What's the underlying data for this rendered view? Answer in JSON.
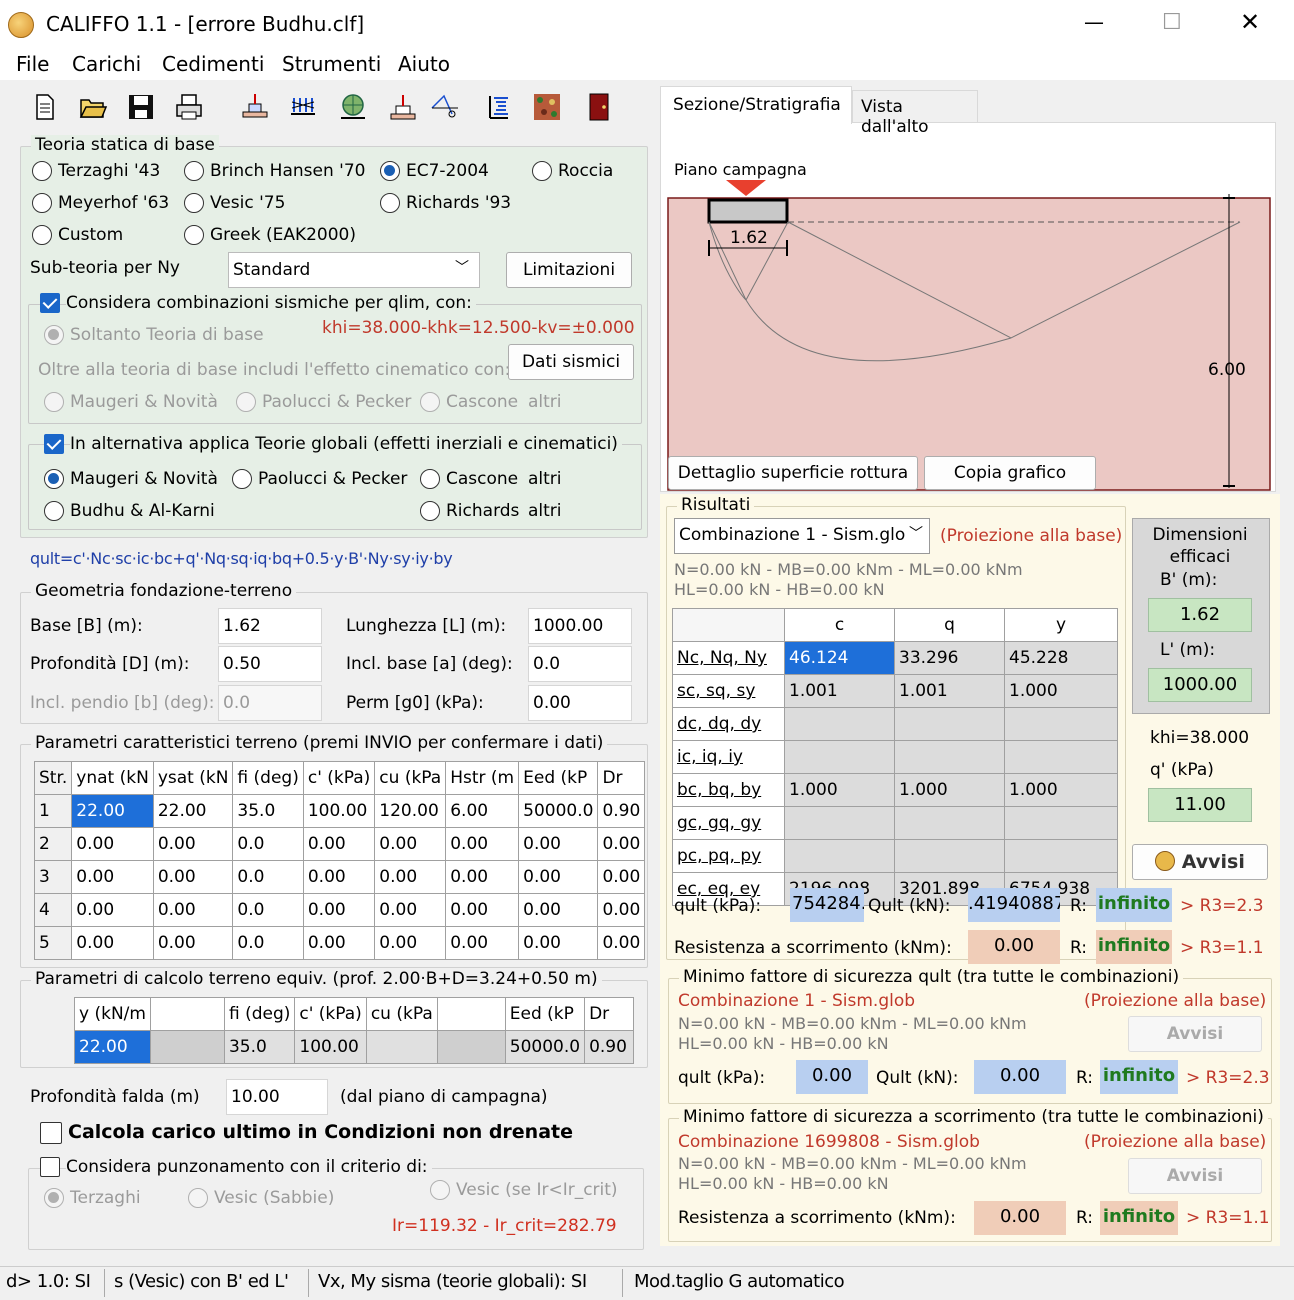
{
  "window": {
    "title": "CALIFFO 1.1 - [errore Budhu.clf]",
    "min": "—",
    "max": "☐",
    "close": "✕"
  },
  "menu": [
    "File",
    "Carichi",
    "Cedimenti",
    "Strumenti",
    "Aiuto"
  ],
  "toolbar_icons": [
    "new-file-icon",
    "open-folder-icon",
    "save-icon",
    "print-icon",
    "foundation-icon",
    "grid-load-icon",
    "globe-icon",
    "footing-icon",
    "profile-icon",
    "spring-icon",
    "soil-texture-icon",
    "exit-door-icon"
  ],
  "theory": {
    "legend": "Teoria statica di base",
    "options": [
      "Terzaghi '43",
      "Brinch Hansen '70",
      "EC7-2004",
      "Roccia",
      "Meyerhof '63",
      "Vesic '75",
      "Richards '93",
      "Custom",
      "Greek (EAK2000)"
    ],
    "selected": "EC7-2004",
    "sub_label": "Sub-teoria per Ny",
    "sub_value": "Standard",
    "limits_button": "Limitazioni",
    "seismic_check": "Considera combinazioni sismiche per qlim, con:",
    "only_base": "Soltanto Teoria di base",
    "khi_text": "khi=38.000-khk=12.500-kv=±0.000",
    "kinematic_label": "Oltre alla teoria di base includi l'effetto cinematico con:",
    "seismic_data_button": "Dati sismici",
    "kinematic_opts": [
      "Maugeri & Novità",
      "Paolucci & Pecker",
      "Cascone",
      "altri"
    ],
    "global_check": "In alternativa applica Teorie globali (effetti inerziali e cinematici)",
    "global_opts": [
      "Maugeri & Novità",
      "Paolucci & Pecker",
      "Cascone",
      "altri",
      "Budhu & Al-Karni",
      "Richards",
      "altri"
    ],
    "formula": "qult=c'·Nc·sc·ic·bc+q'·Nq·sq·iq·bq+0.5·y·B'·Ny·sy·iy·by"
  },
  "geometry": {
    "legend": "Geometria fondazione-terreno",
    "base_label": "Base [B] (m):",
    "base": "1.62",
    "length_label": "Lunghezza [L] (m):",
    "length": "1000.00",
    "depth_label": "Profondità [D] (m):",
    "depth": "0.50",
    "incl_base_label": "Incl. base [a] (deg):",
    "incl_base": "0.0",
    "incl_slope_label": "Incl. pendio [b] (deg):",
    "incl_slope": "0.0",
    "perm_label": "Perm [g0] (kPa):",
    "perm": "0.00"
  },
  "soil": {
    "legend": "Parametri caratteristici terreno (premi INVIO per confermare i dati)",
    "headers": [
      "Str.",
      "ynat (kN",
      "ysat (kN",
      "fi (deg)",
      "c' (kPa)",
      "cu (kPa",
      "Hstr (m",
      "Eed (kP",
      "Dr"
    ],
    "rows": [
      [
        "1",
        "22.00",
        "22.00",
        "35.0",
        "100.00",
        "120.00",
        "6.00",
        "50000.0",
        "0.90"
      ],
      [
        "2",
        "0.00",
        "0.00",
        "0.0",
        "0.00",
        "0.00",
        "0.00",
        "0.00",
        "0.00"
      ],
      [
        "3",
        "0.00",
        "0.00",
        "0.0",
        "0.00",
        "0.00",
        "0.00",
        "0.00",
        "0.00"
      ],
      [
        "4",
        "0.00",
        "0.00",
        "0.0",
        "0.00",
        "0.00",
        "0.00",
        "0.00",
        "0.00"
      ],
      [
        "5",
        "0.00",
        "0.00",
        "0.0",
        "0.00",
        "0.00",
        "0.00",
        "0.00",
        "0.00"
      ]
    ]
  },
  "equiv": {
    "legend": "Parametri di calcolo terreno equiv. (prof. 2.00·B+D=3.24+0.50 m)",
    "headers": [
      "y (kN/m",
      "",
      "fi (deg)",
      "c' (kPa)",
      "cu (kPa",
      "",
      "Eed (kP",
      "Dr"
    ],
    "row": [
      "22.00",
      "",
      "35.0",
      "100.00",
      "",
      "",
      "50000.0",
      "0.90"
    ]
  },
  "water": {
    "label": "Profondità falda (m)",
    "value": "10.00",
    "note": "(dal piano di campagna)"
  },
  "undrained": "Calcola carico ultimo in Condizioni non drenate",
  "punch": {
    "label": "Considera punzonamento con il criterio di:",
    "opts": [
      "Terzaghi",
      "Vesic (Sabbie)",
      "Vesic (se Ir<Ir_crit)"
    ],
    "ir": "Ir=119.32 - Ir_crit=282.79"
  },
  "tabs": [
    "Sezione/Stratigrafia",
    "Vista dall'alto"
  ],
  "section": {
    "ground_label": "Piano campagna",
    "width_label": "1.62",
    "depth_label": "6.00",
    "detail_button": "Dettaglio superficie rottura",
    "copy_button": "Copia grafico"
  },
  "results": {
    "legend": "Risultati",
    "combo": "Combinazione 1 - Sism.glo",
    "projection": "(Proiezione alla base)",
    "forces1": "N=0.00 kN - MB=0.00 kNm - ML=0.00 kNm",
    "forces2": "HL=0.00 kN - HB=0.00 kN",
    "headers": [
      "c",
      "q",
      "y"
    ],
    "rows": [
      [
        "Nc, Nq, Ny",
        "46.124",
        "33.296",
        "45.228"
      ],
      [
        "sc, sq, sy",
        "1.001",
        "1.001",
        "1.000"
      ],
      [
        "dc, dq, dy",
        "",
        "",
        ""
      ],
      [
        "ic, iq, iy",
        "",
        "",
        ""
      ],
      [
        "bc, bq, by",
        "1.000",
        "1.000",
        "1.000"
      ],
      [
        "gc, gq, gy",
        "",
        "",
        ""
      ],
      [
        "pc, pq, py",
        "",
        "",
        ""
      ],
      [
        "ec, eq, ey",
        "2196.098",
        "3201.898",
        "6754.938"
      ]
    ],
    "qult_label": "qult (kPa):",
    "qult": "754284.",
    "Qult_label": "Qult (kN):",
    "Qult": ".41940887",
    "R_label": "R:",
    "R1": "infinito",
    "R1_cmp": "> R3=2.3",
    "slide_label": "Resistenza a scorrimento (kNm):",
    "slide": "0.00",
    "R2": "infinito",
    "R2_cmp": "> R3=1.1",
    "dims": {
      "title": "Dimensioni efficaci",
      "b_label": "B' (m):",
      "b": "1.62",
      "l_label": "L' (m):",
      "l": "1000.00",
      "khi": "khi=38.000",
      "q_label": "q' (kPa)",
      "q": "11.00"
    },
    "warn_button": "Avvisi"
  },
  "min1": {
    "legend": "Minimo fattore di sicurezza qult (tra tutte le combinazioni)",
    "combo": "Combinazione  1 - Sism.glob",
    "projection": "(Proiezione alla base)",
    "forces1": "N=0.00 kN - MB=0.00 kNm - ML=0.00 kNm",
    "forces2": "HL=0.00 kN - HB=0.00 kN",
    "warn": "Avvisi",
    "qult_label": "qult (kPa):",
    "qult": "0.00",
    "Qult_label": "Qult (kN):",
    "Qult": "0.00",
    "R_label": "R:",
    "R": "infinito",
    "cmp": "> R3=2.3"
  },
  "min2": {
    "legend": "Minimo fattore di sicurezza a scorrimento (tra tutte le combinazioni)",
    "combo": "Combinazione  1699808 - Sism.glob",
    "projection": "(Proiezione alla base)",
    "forces1": "N=0.00 kN - MB=0.00 kNm - ML=0.00 kNm",
    "forces2": "HL=0.00 kN - HB=0.00 kN",
    "warn": "Avvisi",
    "slide_label": "Resistenza a scorrimento (kNm):",
    "slide": "0.00",
    "R_label": "R:",
    "R": "infinito",
    "cmp": "> R3=1.1"
  },
  "status": [
    "d> 1.0: SI",
    "s (Vesic) con B' ed L'",
    "Vx, My sisma (teorie globali): SI",
    "Mod.taglio G automatico"
  ]
}
